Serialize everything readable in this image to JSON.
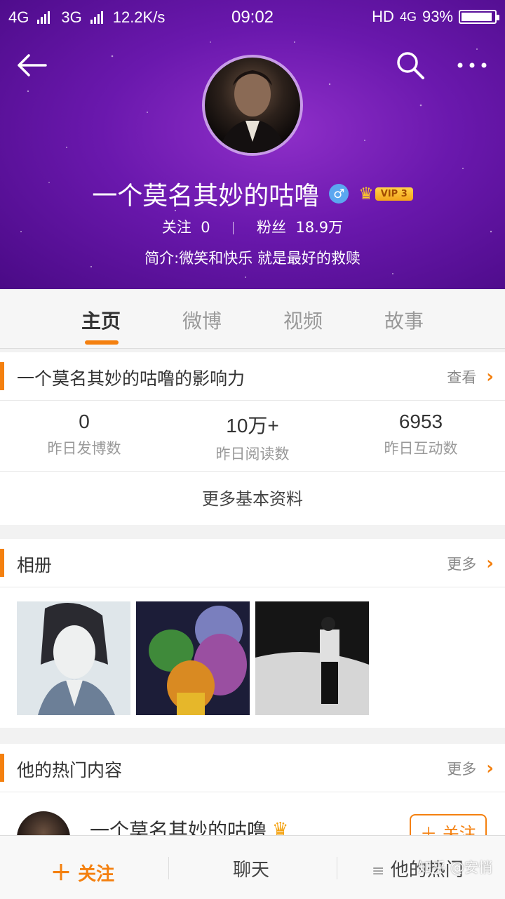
{
  "status_bar": {
    "net1": "4G",
    "net2": "3G",
    "speed": "12.2K/s",
    "time": "09:02",
    "hd": "HD",
    "net3": "4G",
    "battery": "93%",
    "battery_level": 0.93
  },
  "profile": {
    "name": "一个莫名其妙的咕噜",
    "gender_symbol": "♂",
    "vip_label": "VIP 3",
    "following_label": "关注",
    "following_count": "0",
    "followers_label": "粉丝",
    "followers_count": "18.9万",
    "bio": "简介:微笑和快乐 就是最好的救赎"
  },
  "tabs": [
    "主页",
    "微博",
    "视频",
    "故事"
  ],
  "influence": {
    "title": "一个莫名其妙的咕噜的影响力",
    "more": "查看",
    "metrics": [
      {
        "value": "0",
        "label": "昨日发博数"
      },
      {
        "value": "10万+",
        "label": "昨日阅读数"
      },
      {
        "value": "6953",
        "label": "昨日互动数"
      }
    ],
    "more_info": "更多基本资料"
  },
  "album": {
    "title": "相册",
    "more": "更多"
  },
  "hot": {
    "title": "他的热门内容",
    "more": "更多",
    "item_name": "一个莫名其妙的咕噜",
    "follow_label": "关注"
  },
  "bottom_bar": {
    "follow": "关注",
    "chat": "聊天",
    "hot": "他的热门"
  },
  "watermark": "知乎 @安悄",
  "colors": {
    "accent": "#f4800f",
    "header": "#6a18ad"
  }
}
